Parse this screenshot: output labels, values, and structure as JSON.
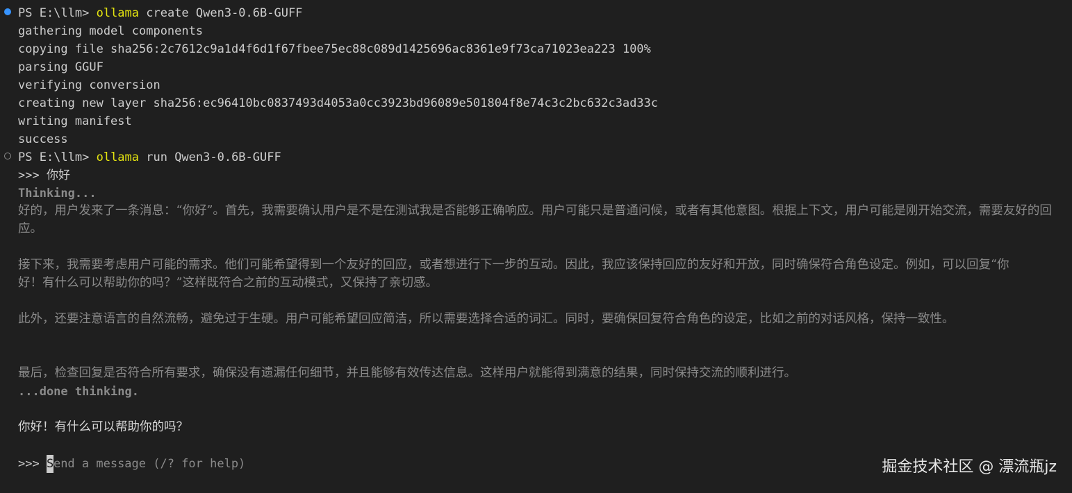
{
  "colors": {
    "background": "#1f1f1f",
    "text": "#cccccc",
    "command": "#e5e510",
    "dim_text": "#8a8a8a",
    "prompt_dot_active": "#3794ff"
  },
  "terminal": {
    "block1": {
      "prompt": "PS E:\\llm> ",
      "command": "ollama",
      "args": " create Qwen3-0.6B-GUFF",
      "output": [
        "gathering model components",
        "copying file sha256:2c7612c9a1d4f6d1f67fbee75ec88c089d1425696ac8361e9f73ca71023ea223 100%",
        "parsing GGUF",
        "verifying conversion",
        "creating new layer sha256:ec96410bc0837493d4053a0cc3923bd96089e501804f8e74c3c2bc632c3ad33c",
        "writing manifest",
        "success"
      ]
    },
    "block2": {
      "prompt": "PS E:\\llm> ",
      "command": "ollama",
      "args": " run Qwen3-0.6B-GUFF"
    },
    "chat": {
      "user_prompt_marker": ">>> ",
      "user_message": "你好",
      "thinking_start": "Thinking...",
      "thinking_paragraphs": [
        "好的，用户发来了一条消息：“你好”。首先，我需要确认用户是不是在测试我是否能够正确响应。用户可能只是普通问候，或者有其他意图。根据上下文，用户可能是刚开始交流，需要友好的回应。",
        "接下来，我需要考虑用户可能的需求。他们可能希望得到一个友好的回应，或者想进行下一步的互动。因此，我应该保持回应的友好和开放，同时确保符合角色设定。例如，可以回复“你好！有什么可以帮助你的吗？”这样既符合之前的互动模式，又保持了亲切感。",
        "此外，还要注意语言的自然流畅，避免过于生硬。用户可能希望回应简洁，所以需要选择合适的词汇。同时，要确保回复符合角色的设定，比如之前的对话风格，保持一致性。",
        "最后，检查回复是否符合所有要求，确保没有遗漏任何细节，并且能够有效传达信息。这样用户就能得到满意的结果，同时保持交流的顺利进行。"
      ],
      "thinking_end": "...done thinking.",
      "assistant_reply": "你好！有什么可以帮助你的吗？",
      "input_marker": ">>> ",
      "input_cursor_char": "S",
      "input_placeholder_rest": "end a message (/? for help)"
    }
  },
  "watermark": "掘金技术社区 @ 漂流瓶jz"
}
